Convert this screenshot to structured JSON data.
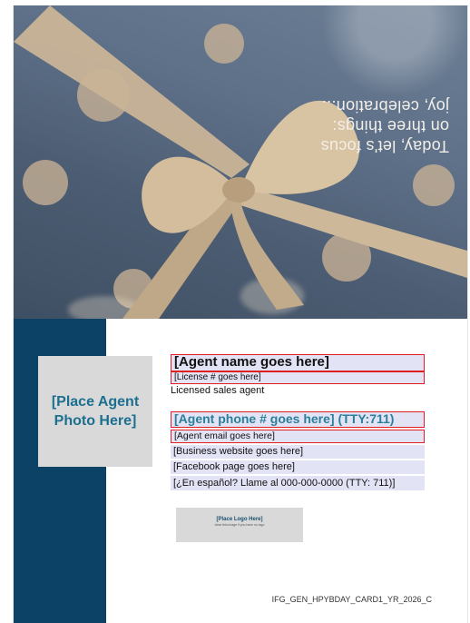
{
  "photo": {
    "lines": [
      "Today, let's focus",
      "on three things:",
      "joy, celebration..."
    ]
  },
  "agent": {
    "photo_placeholder_line1": "[Place Agent",
    "photo_placeholder_line2": "Photo Here]",
    "name": "[Agent name goes here]",
    "license": "[License # goes here]",
    "title": "Licensed sales agent",
    "phone": "[Agent phone # goes here] (TTY:711)",
    "email": "[Agent email goes here]",
    "website": "[Business website goes here]",
    "facebook": "[Facebook page goes here]",
    "spanish": "[¿En español? Llame al 000-000-0000 (TTY: 711)]"
  },
  "logo": {
    "title": "[Place Logo Here]",
    "subtitle": "clear this image if you have no logo"
  },
  "footer": {
    "doc_code": "IFG_GEN_HPYBDAY_CARD1_YR_2026_C"
  },
  "colors": {
    "sidebar": "#0b4265",
    "accent": "#2a7f9b",
    "field_bg": "#e3e3f6",
    "highlight_border": "#e02020"
  }
}
